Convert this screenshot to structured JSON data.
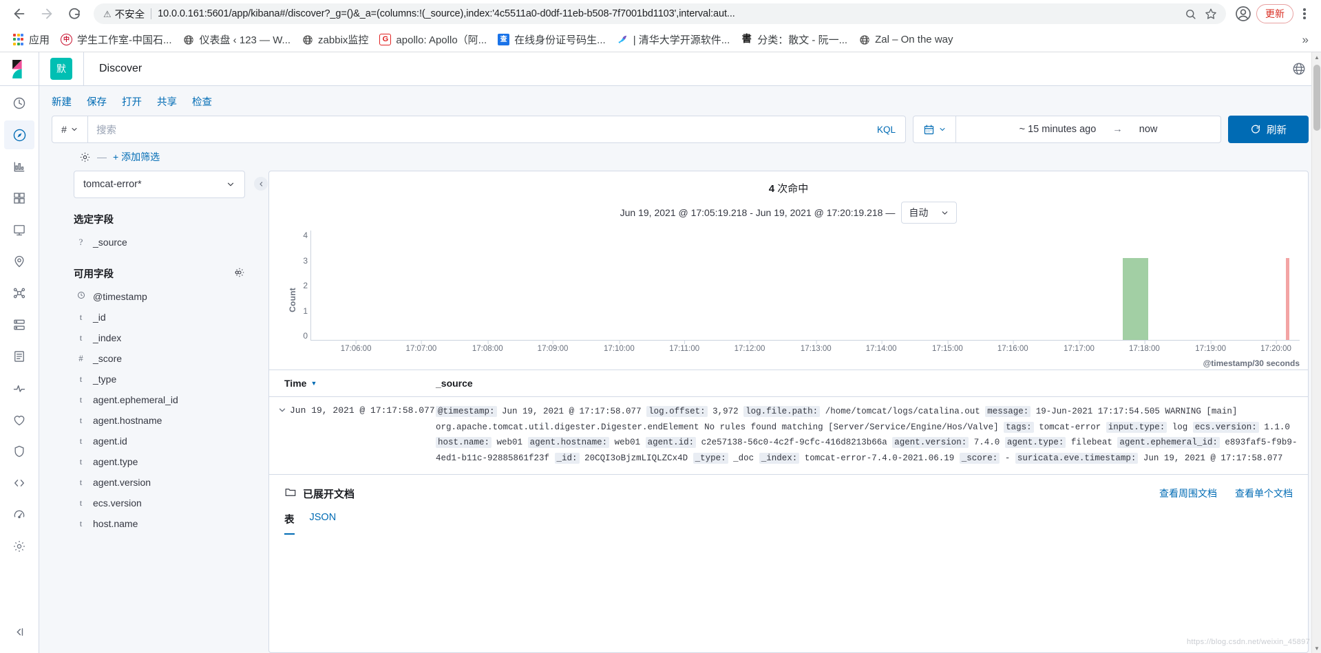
{
  "browser": {
    "back_title": "Back",
    "forward_title": "Forward",
    "reload_title": "Reload",
    "security_label": "不安全",
    "url": "10.0.0.161:5601/app/kibana#/discover?_g=()&_a=(columns:!(_source),index:'4c5511a0-d0df-11eb-b508-7f7001bd1103',interval:aut...",
    "update_label": "更新",
    "bookmarks": [
      {
        "label": "应用",
        "icon": "apps-grid-icon",
        "color": ""
      },
      {
        "label": "学生工作室-中国石...",
        "icon": "seal-icon",
        "color": "#c8102e"
      },
      {
        "label": "仪表盘 ‹ 123 — W...",
        "icon": "globe-icon",
        "color": "#4a4a4a"
      },
      {
        "label": "zabbix监控",
        "icon": "globe-icon",
        "color": "#4a4a4a"
      },
      {
        "label": "apollo: Apollo（阿...",
        "icon": "g-icon",
        "color": "#e02020"
      },
      {
        "label": "在线身份证号码生...",
        "icon": "cha-icon",
        "color": "#1a73e8"
      },
      {
        "label": "| 清华大学开源软件...",
        "icon": "bird-icon",
        "color": "#2196f3"
      },
      {
        "label": "分类：散文 - 阮一...",
        "icon": "brush-icon",
        "color": "#222222"
      },
      {
        "label": "Zal – On the way",
        "icon": "globe-icon",
        "color": "#4a4a4a"
      }
    ],
    "overflow_label": "»"
  },
  "kibana": {
    "space_badge": "默",
    "app_title": "Discover",
    "rail": [
      {
        "name": "recently-viewed-icon",
        "label": "最近查看"
      },
      {
        "name": "discover-icon",
        "label": "Discover"
      },
      {
        "name": "visualize-icon",
        "label": "Visualize"
      },
      {
        "name": "dashboard-icon",
        "label": "Dashboard"
      },
      {
        "name": "canvas-icon",
        "label": "Canvas"
      },
      {
        "name": "maps-icon",
        "label": "Maps"
      },
      {
        "name": "machine-learning-icon",
        "label": "Machine Learning"
      },
      {
        "name": "infrastructure-icon",
        "label": "Infrastructure"
      },
      {
        "name": "logs-icon",
        "label": "Logs"
      },
      {
        "name": "apm-icon",
        "label": "APM"
      },
      {
        "name": "uptime-icon",
        "label": "Uptime"
      },
      {
        "name": "siem-icon",
        "label": "SIEM"
      },
      {
        "name": "dev-tools-icon",
        "label": "Dev Tools"
      },
      {
        "name": "monitoring-icon",
        "label": "Monitoring"
      },
      {
        "name": "management-icon",
        "label": "Management"
      }
    ],
    "rail_collapse": "collapse-icon",
    "topnav": [
      "新建",
      "保存",
      "打开",
      "共享",
      "检查"
    ],
    "query": {
      "prefix_icon": "#",
      "placeholder": "搜索",
      "value": "",
      "language": "KQL"
    },
    "timepicker": {
      "calendar_icon": "calendar-icon",
      "from": "~ 15 minutes ago",
      "arrow": "→",
      "to": "now",
      "refresh_label": "刷新"
    },
    "filters": {
      "gear_icon": "gear-icon",
      "dash": "—",
      "add_label": "+ 添加筛选"
    },
    "sidebar": {
      "index_pattern": "tomcat-error*",
      "selected_title": "选定字段",
      "available_title": "可用字段",
      "settings_icon": "gear-icon",
      "selected_fields": [
        {
          "type": "?",
          "name": "_source"
        }
      ],
      "available_fields": [
        {
          "type": "clock",
          "name": "@timestamp"
        },
        {
          "type": "t",
          "name": "_id"
        },
        {
          "type": "t",
          "name": "_index"
        },
        {
          "type": "#",
          "name": "_score"
        },
        {
          "type": "t",
          "name": "_type"
        },
        {
          "type": "t",
          "name": "agent.ephemeral_id"
        },
        {
          "type": "t",
          "name": "agent.hostname"
        },
        {
          "type": "t",
          "name": "agent.id"
        },
        {
          "type": "t",
          "name": "agent.type"
        },
        {
          "type": "t",
          "name": "agent.version"
        },
        {
          "type": "t",
          "name": "ecs.version"
        },
        {
          "type": "t",
          "name": "host.name"
        }
      ]
    },
    "hits": {
      "count": "4",
      "label": "次命中",
      "range": "Jun 19, 2021 @ 17:05:19.218 - Jun 19, 2021 @ 17:20:19.218 —",
      "interval": "自动"
    },
    "table": {
      "col_time": "Time",
      "col_source": "_source",
      "sort_icon": "sort-desc-icon"
    },
    "document": {
      "expand_icon": "chevron-down-icon",
      "time": "Jun 19, 2021 @ 17:17:58.077",
      "fields": [
        {
          "key": "@timestamp:",
          "value": "Jun 19, 2021 @ 17:17:58.077"
        },
        {
          "key": "log.offset:",
          "value": "3,972"
        },
        {
          "key": "log.file.path:",
          "value": "/home/tomcat/logs/catalina.out"
        },
        {
          "key": "message:",
          "value": "19-Jun-2021 17:17:54.505 WARNING [main] org.apache.tomcat.util.digester.Digester.endElement No rules found matching [Server/Service/Engine/Hos/Valve]"
        },
        {
          "key": "tags:",
          "value": "tomcat-error"
        },
        {
          "key": "input.type:",
          "value": "log"
        },
        {
          "key": "ecs.version:",
          "value": "1.1.0"
        },
        {
          "key": "host.name:",
          "value": "web01"
        },
        {
          "key": "agent.hostname:",
          "value": "web01"
        },
        {
          "key": "agent.id:",
          "value": "c2e57138-56c0-4c2f-9cfc-416d8213b66a"
        },
        {
          "key": "agent.version:",
          "value": "7.4.0"
        },
        {
          "key": "agent.type:",
          "value": "filebeat"
        },
        {
          "key": "agent.ephemeral_id:",
          "value": "e893faf5-f9b9-4ed1-b11c-92885861f23f"
        },
        {
          "key": "_id:",
          "value": "20CQI3oBjzmLIQLZCx4D"
        },
        {
          "key": "_type:",
          "value": "_doc"
        },
        {
          "key": "_index:",
          "value": "tomcat-error-7.4.0-2021.06.19"
        },
        {
          "key": "_score:",
          "value": "-"
        },
        {
          "key": "suricata.eve.timestamp:",
          "value": "Jun 19, 2021 @ 17:17:58.077"
        }
      ]
    },
    "expanded_doc": {
      "folder_icon": "folder-icon",
      "title": "已展开文档",
      "link_surrounding": "查看周围文档",
      "link_single": "查看单个文档",
      "tabs": [
        {
          "label": "表",
          "active": true
        },
        {
          "label": "JSON",
          "active": false
        }
      ]
    },
    "watermark": "https://blog.csdn.net/weixin_45897"
  },
  "chart_data": {
    "type": "bar",
    "title": "",
    "xlabel": "@timestamp/30 seconds",
    "ylabel": "Count",
    "ylim": [
      0,
      4
    ],
    "yticks": [
      0,
      1,
      2,
      3,
      4
    ],
    "x_start": "17:05:19.218",
    "x_end": "17:20:19.218",
    "xticks": [
      "17:06:00",
      "17:07:00",
      "17:08:00",
      "17:09:00",
      "17:10:00",
      "17:11:00",
      "17:12:00",
      "17:13:00",
      "17:14:00",
      "17:15:00",
      "17:16:00",
      "17:17:00",
      "17:18:00",
      "17:19:00",
      "17:20:00"
    ],
    "bars": [
      {
        "time": "17:17:30",
        "count": 3,
        "color": "#a2cfa4",
        "wide": true
      },
      {
        "time": "17:20:00",
        "count": 3,
        "color": "#f3a4a4",
        "wide": false
      }
    ],
    "grid": false,
    "legend": "none",
    "total_hits": 4
  }
}
